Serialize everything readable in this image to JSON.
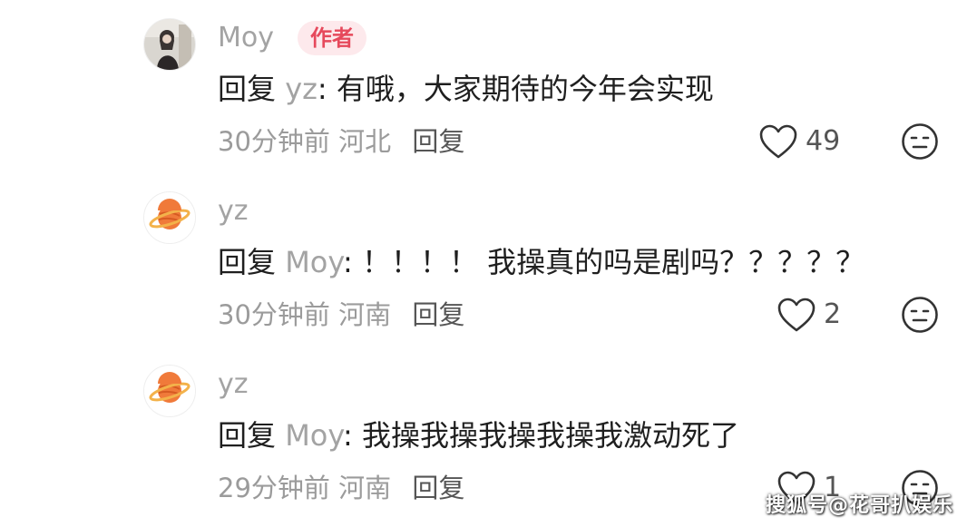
{
  "comments": [
    {
      "username": "Moy",
      "badge": "作者",
      "reply_prefix": "回复",
      "reply_target": "yz",
      "reply_colon": ":",
      "text": " 有哦，大家期待的今年会实现",
      "time": "30分钟前",
      "location": "河北",
      "reply_label": "回复",
      "likes": "49",
      "avatar_icon": "photo-avatar"
    },
    {
      "username": "yz",
      "reply_prefix": "回复",
      "reply_target": "Moy",
      "reply_colon": ":",
      "text": " ！！！！ 我操真的吗是剧吗？？？？？",
      "time": "30分钟前",
      "location": "河南",
      "reply_label": "回复",
      "likes": "2",
      "avatar_icon": "planet-icon"
    },
    {
      "username": "yz",
      "reply_prefix": "回复",
      "reply_target": "Moy",
      "reply_colon": ":",
      "text": " 我操我操我操我操我激动死了",
      "time": "29分钟前",
      "location": "河南",
      "reply_label": "回复",
      "likes": "1",
      "avatar_icon": "planet-icon"
    }
  ],
  "watermark": "搜狐号@花哥扒娱乐",
  "colors": {
    "badge_bg": "#fde9ec",
    "badge_text": "#e6495c",
    "muted": "#a3a3a3",
    "text": "#1f1f1f"
  }
}
